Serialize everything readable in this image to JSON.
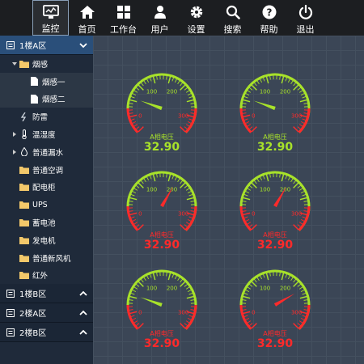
{
  "nav": {
    "items": [
      {
        "label": "监控",
        "icon": "monitor-icon",
        "active": true
      },
      {
        "label": "首页",
        "icon": "home-icon"
      },
      {
        "label": "工作台",
        "icon": "grid-icon"
      },
      {
        "label": "用户",
        "icon": "user-icon"
      },
      {
        "label": "设置",
        "icon": "gear-icon"
      },
      {
        "label": "搜索",
        "icon": "search-icon"
      },
      {
        "label": "帮助",
        "icon": "help-icon"
      },
      {
        "label": "退出",
        "icon": "power-icon"
      }
    ]
  },
  "sidebar": {
    "sections": [
      {
        "label": "1楼A区",
        "open": true
      },
      {
        "label": "1楼B区",
        "open": false
      },
      {
        "label": "2楼A区",
        "open": false
      },
      {
        "label": "2楼B区",
        "open": false
      }
    ],
    "tree": [
      {
        "label": "烟感",
        "icon": "folder-icon",
        "caret": "down",
        "level": 0
      },
      {
        "label": "烟感一",
        "icon": "file-icon",
        "level": 1
      },
      {
        "label": "烟感二",
        "icon": "file-icon",
        "level": 1
      },
      {
        "label": "防雷",
        "icon": "lightning-icon",
        "level": 0
      },
      {
        "label": "温湿度",
        "icon": "thermometer-icon",
        "caret": "right",
        "level": 0
      },
      {
        "label": "普通漏水",
        "icon": "water-drop-icon",
        "caret": "right",
        "level": 0
      },
      {
        "label": "普通空调",
        "icon": "folder-icon",
        "level": 0
      },
      {
        "label": "配电柜",
        "icon": "folder-icon",
        "level": 0
      },
      {
        "label": "UPS",
        "icon": "folder-icon",
        "level": 0
      },
      {
        "label": "蓄电池",
        "icon": "folder-icon",
        "level": 0
      },
      {
        "label": "发电机",
        "icon": "folder-icon",
        "level": 0
      },
      {
        "label": "普通新风机",
        "icon": "folder-icon",
        "level": 0
      },
      {
        "label": "红外",
        "icon": "folder-icon",
        "level": 0
      }
    ]
  },
  "gauges": [
    {
      "title": "A相电压",
      "value_text": "32.90",
      "needle": 32.9,
      "title_color": "#a8e22a",
      "value_color": "#a8e22a",
      "needle_color": "#a8e22a"
    },
    {
      "title": "A相电压",
      "value_text": "32.90",
      "needle": 32.9,
      "title_color": "#a8e22a",
      "value_color": "#a8e22a",
      "needle_color": "#a8e22a"
    },
    {
      "title": "A相电压",
      "value_text": "32.90",
      "needle": 200,
      "title_color": "#ff2a2a",
      "value_color": "#ff2a2a",
      "needle_color": "#ff2a2a"
    },
    {
      "title": "A相电压",
      "value_text": "32.90",
      "needle": 200,
      "title_color": "#ff2a2a",
      "value_color": "#ff2a2a",
      "needle_color": "#ff2a2a"
    },
    {
      "title": "A相电压",
      "value_text": "32.90",
      "needle": 32.9,
      "title_color": "#ff2a2a",
      "value_color": "#ff2a2a",
      "needle_color": "#a8e22a"
    },
    {
      "title": "A相电压",
      "value_text": "32.90",
      "needle": 250,
      "title_color": "#ff2a2a",
      "value_color": "#ff2a2a",
      "needle_color": "#ff2a2a"
    }
  ],
  "gauge_scale": {
    "min": 0,
    "max": 300,
    "labels": [
      "0",
      "100",
      "200",
      "300"
    ]
  },
  "colors": {
    "green": "#a8e22a",
    "red": "#ff2a2a",
    "nav_bg": "#1c1e21",
    "sidebar_active": "#2a4f7a"
  }
}
